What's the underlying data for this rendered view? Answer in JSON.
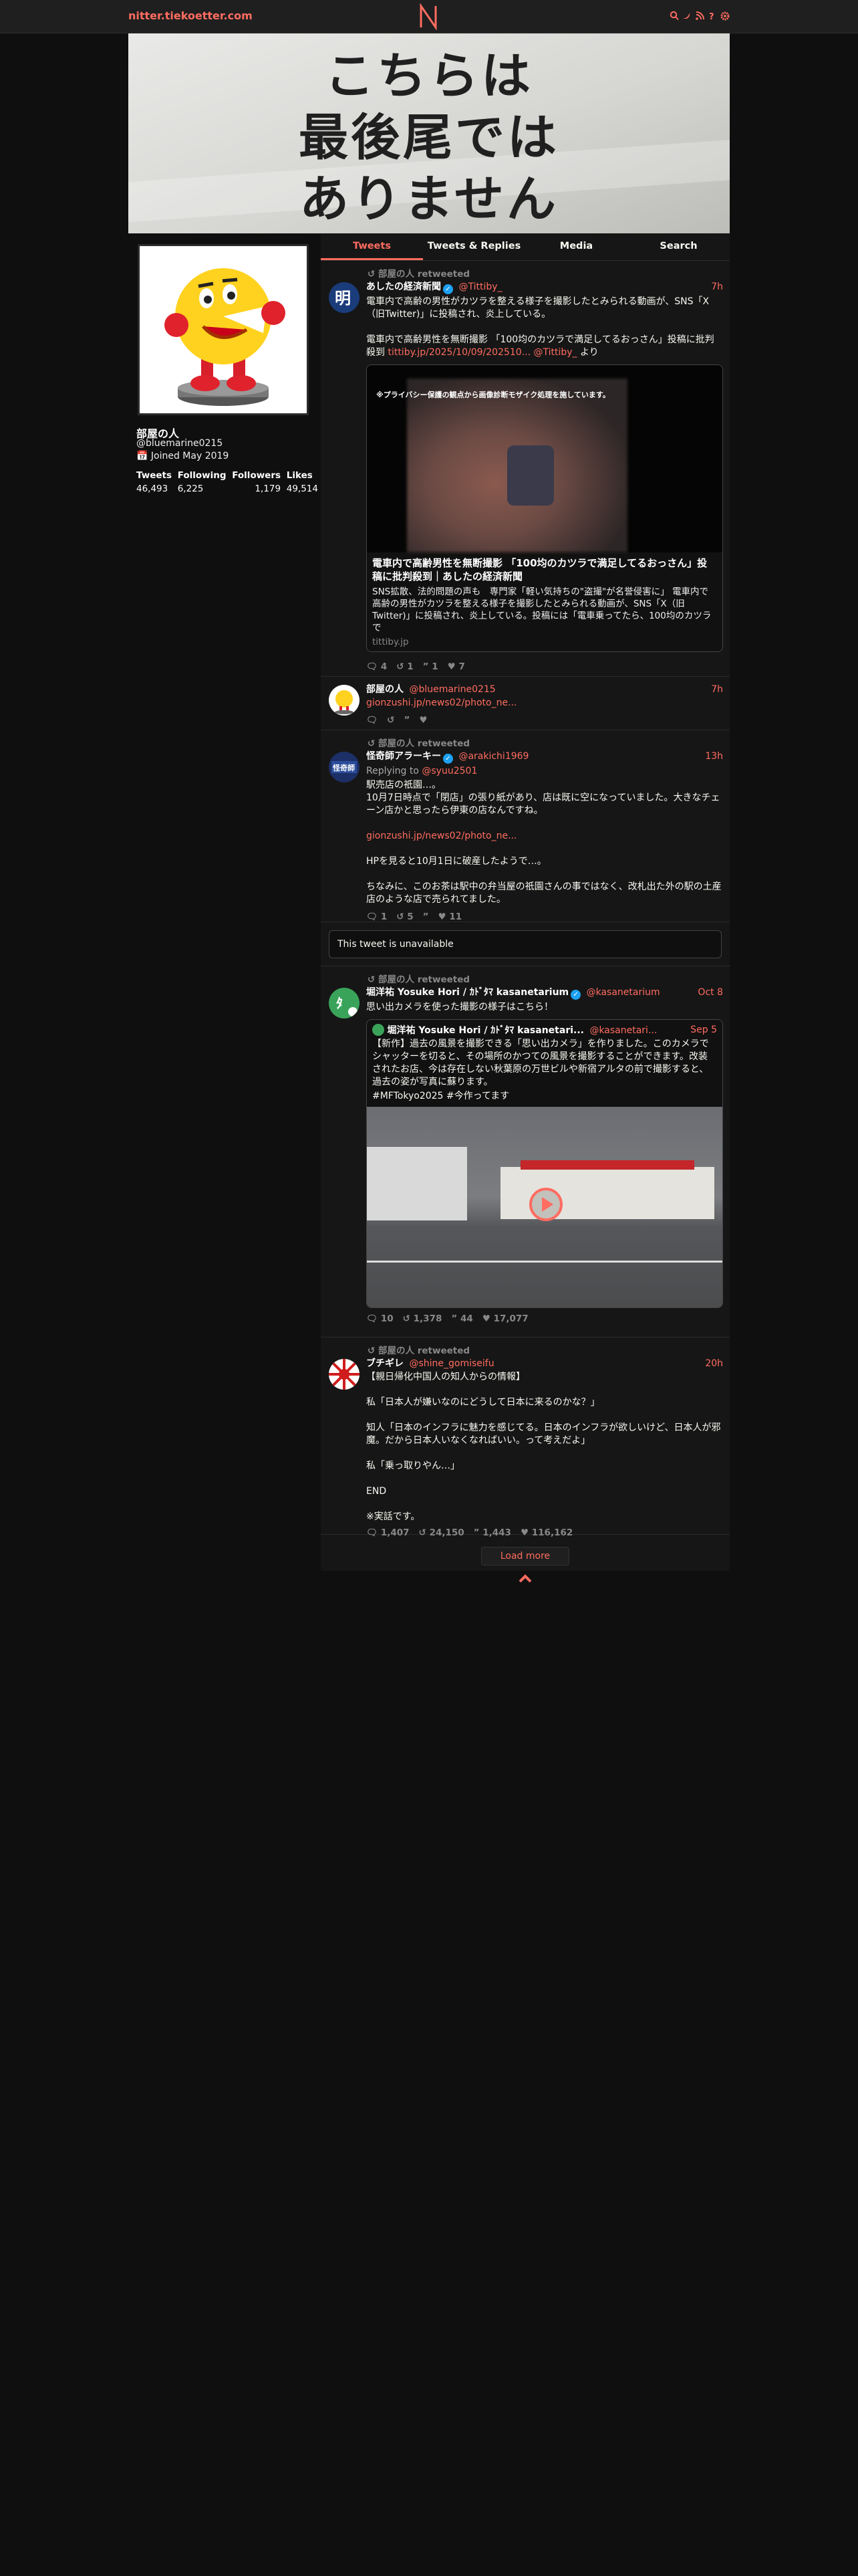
{
  "nav": {
    "site": "nitter.tiekoetter.com"
  },
  "banner": {
    "lines": [
      "こちらは",
      "最後尾では",
      "ありません"
    ]
  },
  "profile": {
    "name": "部屋の人",
    "handle": "@bluemarine0215",
    "joined": "Joined May 2019",
    "stats": [
      {
        "label": "Tweets",
        "value": "46,493"
      },
      {
        "label": "Following",
        "value": "6,225"
      },
      {
        "label": "Followers",
        "value": "1,179"
      },
      {
        "label": "Likes",
        "value": "49,514"
      }
    ]
  },
  "tabs": [
    "Tweets",
    "Tweets & Replies",
    "Media",
    "Search"
  ],
  "tweets": [
    {
      "retweet": "部屋の人 retweeted",
      "name": "あしたの経済新聞",
      "handle": "@Tittiby_",
      "date": "7h",
      "text1": "電車内で高齢の男性がカツラを整える様子を撮影したとみられる動画が、SNS「X（旧Twitter)」に投稿され、炎上している。",
      "text2": "電車内で高齢男性を無断撮影 「100均のカツラで満足してるおっさん」投稿に批判殺到",
      "link1": "tittiby.jp/2025/10/09/202510...",
      "link2": "@Tittiby_",
      "suffix": "より",
      "card_caption": "※プライバシー保護の観点から画像診断モザイク処理を施しています。",
      "card_title": "電車内で高齢男性を無断撮影 「100均のカツラで満足してるおっさん」投稿に批判殺到｜あしたの経済新聞",
      "card_desc": "SNS拡散、法的問題の声も　専門家「軽い気持ちの\"盗撮\"が名誉侵害に」 電車内で高齢の男性がカツラを整える様子を撮影したとみられる動画が、SNS「X（旧Twitter)」に投稿され、炎上している。投稿には「電車乗ってたら、100均のカツラで",
      "card_domain": "tittiby.jp",
      "stats": {
        "replies": "4",
        "retweets": "1",
        "quotes": "1",
        "likes": "7"
      }
    },
    {
      "name": "部屋の人",
      "handle": "@bluemarine0215",
      "date": "7h",
      "link": "gionzushi.jp/news02/photo_ne..."
    },
    {
      "retweet": "部屋の人 retweeted",
      "name": "怪奇師アラーキー",
      "handle": "@arakichi1969",
      "date": "13h",
      "replying": "Replying to",
      "replying_to": "@syuu2501",
      "p1a": "駅売店の祇園…。",
      "p1b": "10月7日時点で「閉店」の張り紙があり、店は既に空になっていました。大きなチェーン店かと思ったら伊東の店なんですね。",
      "link": "gionzushi.jp/news02/photo_ne...",
      "p2": "HPを見ると10月1日に破産したようで…。",
      "p3": "ちなみに、このお茶は駅中の弁当屋の祇園さんの事ではなく、改札出た外の駅の土産店のような店で売られてました。",
      "stats": {
        "replies": "1",
        "retweets": "5",
        "quotes": "",
        "likes": "11"
      }
    },
    {
      "unavailable": "This tweet is unavailable"
    },
    {
      "retweet": "部屋の人 retweeted",
      "name": "堀洋祐 Yosuke Hori / ｶﾄﾞﾀﾏ kasanetarium",
      "handle": "@kasanetarium",
      "date": "Oct 8",
      "text": "思い出カメラを使った撮影の様子はこちら！",
      "quote_name": "堀洋祐 Yosuke Hori / ｶﾄﾞﾀﾏ kasanetari...",
      "quote_handle": "@kasanetari...",
      "quote_date": "Sep 5",
      "quote_text": "【新作】過去の風景を撮影できる「思い出カメラ」を作りました。このカメラでシャッターを切ると、その場所のかつての風景を撮影することができます。改装されたお店、今は存在しない秋葉原の万世ビルや新宿アルタの前で撮影すると、過去の姿が写真に蘇ります。",
      "quote_tags": "#MFTokyo2025 #今作ってます",
      "stats": {
        "replies": "10",
        "retweets": "1,378",
        "quotes": "44",
        "likes": "17,077"
      }
    },
    {
      "retweet": "部屋の人 retweeted",
      "name": "ブチギレ",
      "handle": "@shine_gomiseifu",
      "date": "20h",
      "lines": [
        "【親日帰化中国人の知人からの情報】",
        "私「日本人が嫌いなのにどうして日本に来るのかな？」",
        "知人「日本のインフラに魅力を感じてる。日本のインフラが欲しいけど、日本人が邪魔。だから日本人いなくなればいい。って考えだよ」",
        "私「乗っ取りやん…」",
        "END",
        "※実話です。"
      ],
      "stats": {
        "replies": "1,407",
        "retweets": "24,150",
        "quotes": "1,443",
        "likes": "116,162"
      }
    }
  ],
  "load_more": "Load more",
  "colors": {
    "accent": "#ff6c60",
    "bg": "#0f0f0f",
    "panel": "#161616"
  }
}
